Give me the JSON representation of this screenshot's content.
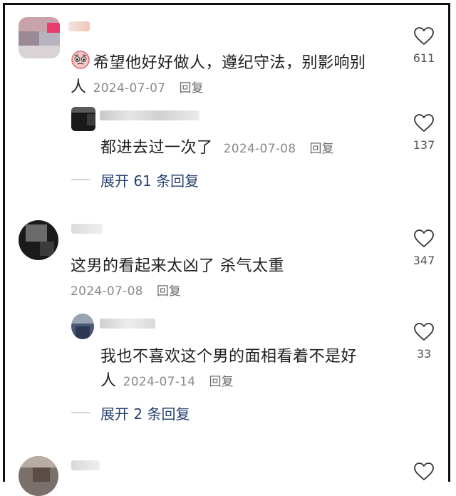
{
  "comments": [
    {
      "text_line1": "希望他好好做人，遵纪守法，别影响别",
      "text_line2": "人",
      "date": "2024-07-07",
      "reply_label": "回复",
      "likes": "611"
    },
    {
      "text": "都进去过一次了",
      "date": "2024-07-08",
      "reply_label": "回复",
      "likes": "137"
    },
    {
      "expand_label": "展开 61 条回复"
    },
    {
      "text": "这男的看起来太凶了 杀气太重",
      "date": "2024-07-08",
      "reply_label": "回复",
      "likes": "347"
    },
    {
      "text_line1": "我也不喜欢这个男的面相看着不是好",
      "text_line2": "人",
      "date": "2024-07-14",
      "reply_label": "回复",
      "likes": "33"
    },
    {
      "expand_label": "展开 2 条回复"
    }
  ],
  "colors": {
    "expand_link": "#24406e",
    "meta_gray": "#8a8a8a",
    "heart_stroke": "#333333"
  },
  "icons": {
    "like": "heart-outline-icon",
    "emoji": "pleading-face-emoji-icon"
  }
}
